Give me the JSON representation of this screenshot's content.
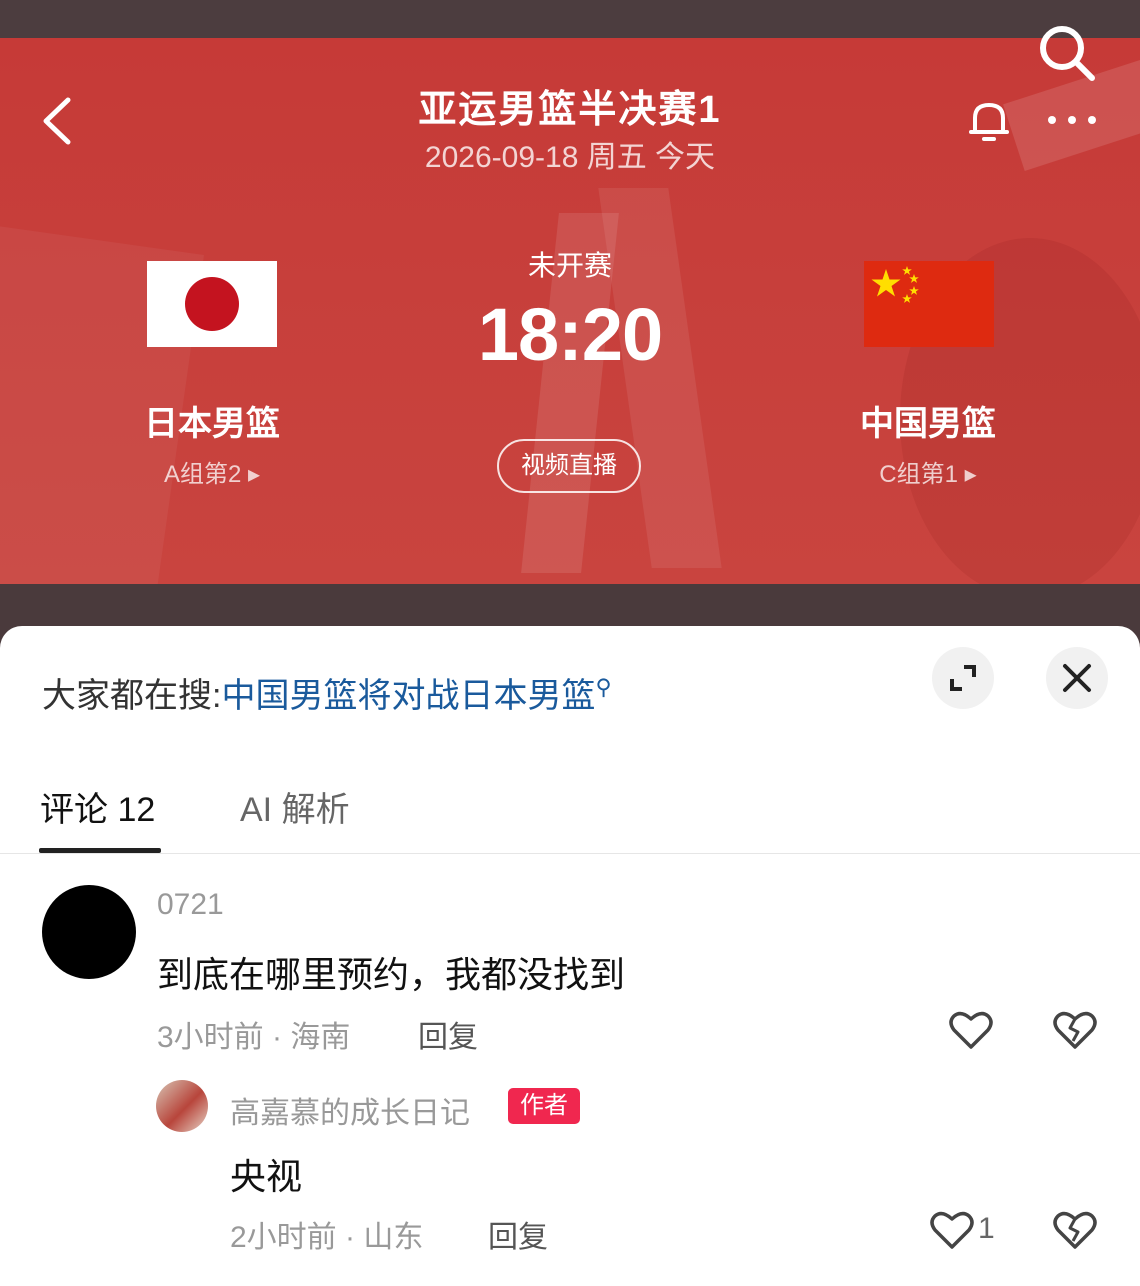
{
  "header": {
    "title": "亚运男篮半决赛1",
    "date": "2026-09-18 周五 今天",
    "back_icon": "chevron-left-icon",
    "search_icon": "search-icon",
    "bell_icon": "bell-icon",
    "more_icon": "more-icon"
  },
  "match": {
    "status": "未开赛",
    "time": "18:20",
    "live_button": "视频直播",
    "home": {
      "name": "日本男篮",
      "group": "A组第2 ▸"
    },
    "away": {
      "name": "中国男篮",
      "group": "C组第1 ▸"
    }
  },
  "search_hint": {
    "prefix": "大家都在搜:",
    "query": "中国男篮将对战日本男篮",
    "query_icon": "search-icon"
  },
  "sheet_buttons": {
    "expand_icon": "expand-icon",
    "close_icon": "close-icon"
  },
  "tabs": [
    {
      "label": "评论 12",
      "active": true
    },
    {
      "label": "AI 解析",
      "active": false
    }
  ],
  "comments": [
    {
      "user": "0721",
      "text": "到底在哪里预约，我都没找到",
      "meta": "3小时前 · 海南",
      "reply_label": "回复",
      "replies": [
        {
          "user": "高嘉慕的成长日记",
          "badge": "作者",
          "text": "央视",
          "meta": "2小时前 · 山东",
          "reply_label": "回复",
          "likes": "1"
        }
      ]
    }
  ],
  "colors": {
    "hero_red": "#c63a37",
    "link_blue": "#1a5a9c",
    "badge_red": "#f0274f"
  }
}
